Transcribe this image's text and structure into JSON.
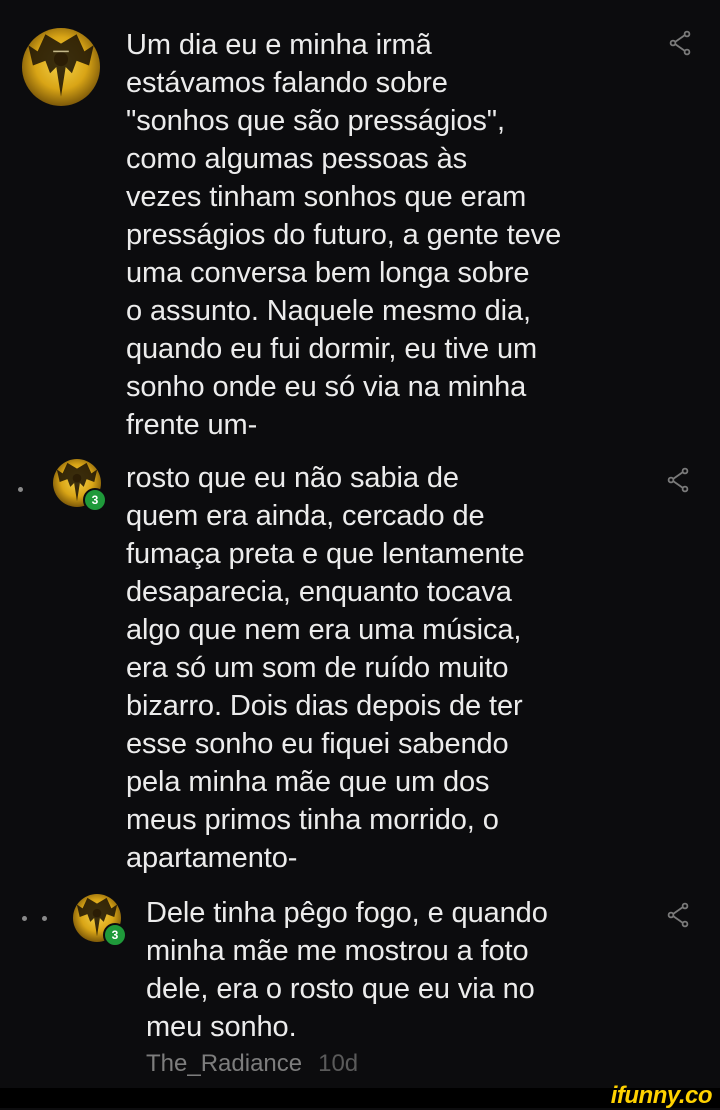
{
  "comments": [
    {
      "text": "Um dia eu e minha irmã\nestávamos falando sobre\n\"sonhos que são presságios\",\ncomo algumas pessoas às\nvezes tinham sonhos que eram\npresságios do futuro, a gente teve\numa conversa bem longa sobre\no assunto. Naquele mesmo dia,\nquando eu fui dormir, eu tive um\nsonho onde eu só via na minha\nfrente um-",
      "avatar_icon": "winged-skull-avatar",
      "share_icon": "share-icon"
    },
    {
      "text": "rosto que eu não sabia de\nquem era ainda, cercado de\nfumaça preta e que lentamente\ndesaparecia, enquanto tocava\nalgo que nem era uma música,\nera só um som de ruído muito\nbizarro. Dois dias depois de ter\nesse sonho eu fiquei sabendo\npela minha mãe que um dos\nmeus primos tinha morrido, o\napartamento-",
      "avatar_icon": "winged-skull-avatar",
      "level": "3",
      "share_icon": "share-icon"
    },
    {
      "text": "Dele tinha pêgo fogo, e quando\nminha mãe me mostrou a foto\ndele, era o rosto que eu via no\nmeu sonho.",
      "avatar_icon": "winged-skull-avatar",
      "level": "3",
      "username": "The_Radiance",
      "time": "10d",
      "share_icon": "share-icon"
    }
  ],
  "watermark": "ifunny.co",
  "colors": {
    "background": "#0c0c0e",
    "text": "#ececec",
    "meta": "#7d7d7d",
    "badge": "#1f9a3a",
    "watermark": "#ffd200"
  }
}
